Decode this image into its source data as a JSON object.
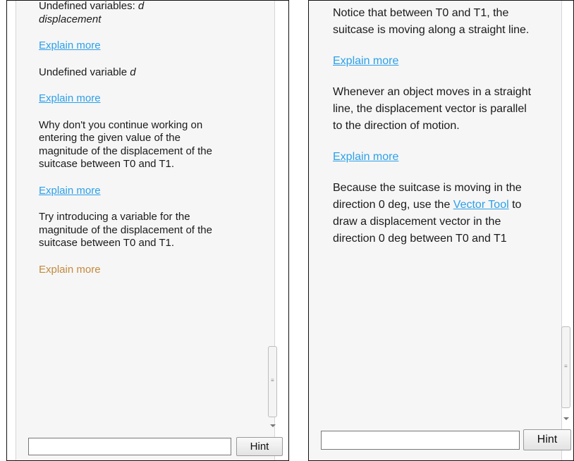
{
  "left_panel": {
    "messages": [
      {
        "pre": "Undefined variables: ",
        "var": "d",
        "var2": "displacement"
      },
      {
        "link": "Explain more"
      },
      {
        "pre": "Undefined variable ",
        "var": "d"
      },
      {
        "link": "Explain more"
      },
      {
        "text": "Why don't you continue working on entering the given value of the magnitude of the displacement of the suitcase between T0 and T1."
      },
      {
        "link": "Explain more"
      },
      {
        "text": "Try introducing a variable for the magnitude of the displacement of the suitcase between T0 and T1."
      },
      {
        "link": "Explain more"
      }
    ],
    "hint_input_value": "",
    "hint_button_label": "Hint"
  },
  "right_panel": {
    "messages": [
      {
        "text": "Notice that between T0 and T1, the suitcase is moving along a straight line."
      },
      {
        "link": "Explain more"
      },
      {
        "text": "Whenever an object moves in a straight line, the displacement vector is parallel to the direction of motion."
      },
      {
        "link": "Explain more"
      },
      {
        "pre": "Because the suitcase is moving in the direction 0 deg, use the ",
        "tool_link": "Vector Tool",
        "post": " to draw a displacement vector in the direction 0 deg between T0 and T1"
      }
    ],
    "hint_input_value": "",
    "hint_button_label": "Hint"
  },
  "colors": {
    "link": "#2ba0ea",
    "visited_link": "#c38a3c",
    "panel_background": "#f6f6f6",
    "text": "#1a1a1a"
  }
}
